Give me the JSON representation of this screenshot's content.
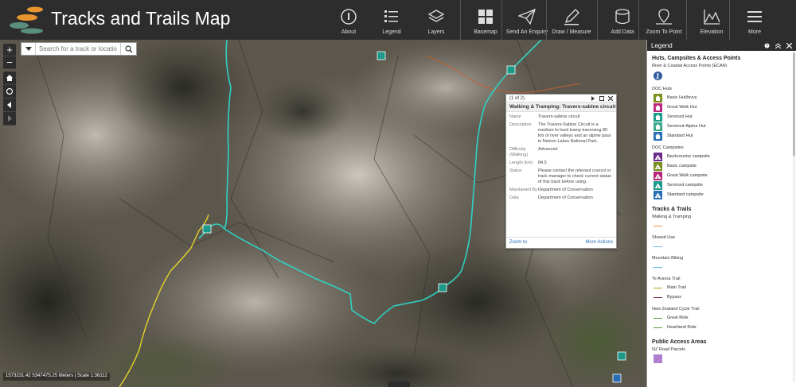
{
  "app": {
    "title": "Tracks and Trails Map"
  },
  "toolbar": [
    {
      "label": "About",
      "icon": "info-icon"
    },
    {
      "label": "Legend",
      "icon": "legend-icon"
    },
    {
      "label": "Layers",
      "icon": "layers-icon"
    },
    {
      "label": "Basemap",
      "icon": "basemap-icon"
    },
    {
      "label": "Send An Enquiry",
      "icon": "paper-plane-icon"
    },
    {
      "label": "Draw / Measure",
      "icon": "pencil-icon"
    },
    {
      "label": "Add Data",
      "icon": "add-data-icon"
    },
    {
      "label": "Zoom To Point",
      "icon": "map-pin-icon"
    },
    {
      "label": "Elevation",
      "icon": "elevation-icon"
    },
    {
      "label": "More",
      "icon": "hamburger-icon"
    }
  ],
  "map_controls": {
    "zoom_in": "+",
    "zoom_out": "−"
  },
  "search": {
    "placeholder": "Search for a track or locatio"
  },
  "coords": "1573231.42 5347475.25 Meters | Scale 1:36112",
  "popup": {
    "counter": "(1 of 2)",
    "title": "Walking & Tramping: Travers-sabine circuit",
    "rows": [
      {
        "key": "Name",
        "value": "Travers-sabine circuit"
      },
      {
        "key": "Description",
        "value": "The Travers-Sabine Circuit is a medium to hard tramp traversing 80 km of river valleys and an alpine pass in Nelson Lakes National Park."
      },
      {
        "key": "Difficulty (Walking)",
        "value": "Advanced"
      },
      {
        "key": "Length (km)",
        "value": "84.5"
      },
      {
        "key": "Status",
        "value": "Please contact the relevant council or track manager to check current status of this track before using."
      },
      {
        "key": "Maintained By",
        "value": "Department of Conservation"
      },
      {
        "key": "Data",
        "value": "Department of Conservation"
      }
    ],
    "zoom_link": "Zoom to",
    "more_link": "More Actions"
  },
  "legend": {
    "title": "Legend",
    "sections": [
      {
        "heading": "Huts, Campsites & Access Points",
        "groups": [
          {
            "label": "River & Coastal Access Points (ECAN)",
            "items": [
              {
                "label": "",
                "kind": "access",
                "color": "#2f5b9e"
              }
            ]
          },
          {
            "label": "DOC Huts",
            "items": [
              {
                "label": "Basic Hut/bivvy",
                "kind": "hut",
                "color": "#7a8f1e"
              },
              {
                "label": "Great Walk Hut",
                "kind": "hut",
                "color": "#c0267e"
              },
              {
                "label": "Serviced Hut",
                "kind": "hut",
                "color": "#1b9a8a"
              },
              {
                "label": "Serviced-Alpine Hut",
                "kind": "hut",
                "color": "#3ca78b"
              },
              {
                "label": "Standard Hut",
                "kind": "hut",
                "color": "#2b6fb5"
              }
            ]
          },
          {
            "label": "DOC Campsites",
            "items": [
              {
                "label": "Backcountry campsite",
                "kind": "tent",
                "color": "#6a2a8c"
              },
              {
                "label": "Basic campsite",
                "kind": "tent",
                "color": "#7a8f1e"
              },
              {
                "label": "Great Walk campsite",
                "kind": "tent",
                "color": "#b5287a"
              },
              {
                "label": "Serviced campsite",
                "kind": "tent",
                "color": "#1b9a8a"
              },
              {
                "label": "Standard campsite",
                "kind": "tent",
                "color": "#2b6fb5"
              }
            ]
          }
        ]
      },
      {
        "heading": "Tracks & Trails",
        "groups": [
          {
            "label": "Walking & Tramping",
            "items": [
              {
                "label": "",
                "kind": "line",
                "color": "#e89040"
              }
            ]
          },
          {
            "label": "Shared Use",
            "items": [
              {
                "label": "",
                "kind": "line",
                "color": "#6fb6e0"
              }
            ]
          },
          {
            "label": "Mountain Biking",
            "items": [
              {
                "label": "",
                "kind": "line",
                "color": "#6fb6e0"
              }
            ]
          },
          {
            "label": "Te Araroa Trail",
            "items": [
              {
                "label": "Main Trail",
                "kind": "line",
                "color": "#b5a020"
              },
              {
                "label": "Bypass",
                "kind": "line",
                "color": "#7a1f4f"
              }
            ]
          },
          {
            "label": "New Zealand Cycle Trail",
            "items": [
              {
                "label": "Great Ride",
                "kind": "line",
                "color": "#4a9a3a"
              },
              {
                "label": "Heartland Ride",
                "kind": "line",
                "color": "#4a9a3a"
              }
            ]
          }
        ]
      },
      {
        "heading": "Public Access Areas",
        "groups": [
          {
            "label": "NZ Road Parcels",
            "items": [
              {
                "label": "",
                "kind": "fill",
                "color": "#b07fd0"
              }
            ]
          }
        ]
      }
    ]
  }
}
